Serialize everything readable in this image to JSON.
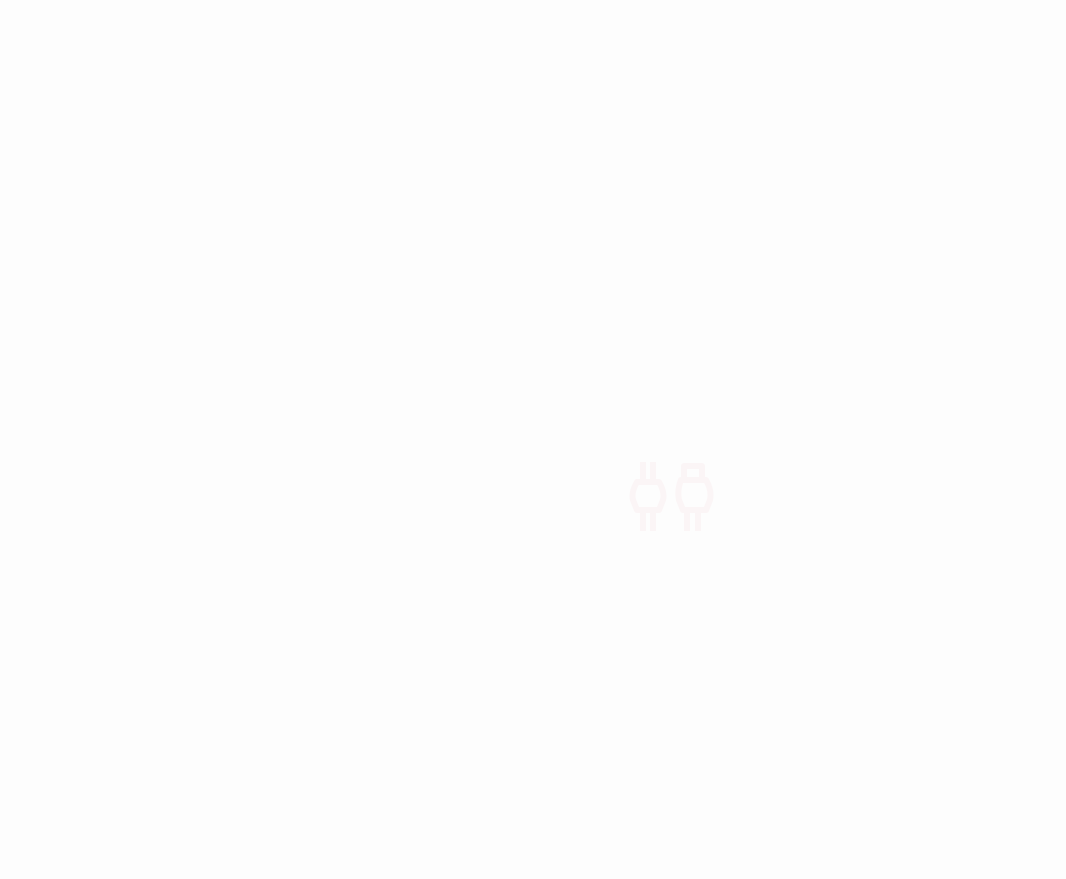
{
  "screen": {
    "background_color": "#fdfdfd"
  },
  "disconnected_graphic": {
    "icon": "unplugged-connector-icon",
    "color": "#fbf5f6"
  }
}
